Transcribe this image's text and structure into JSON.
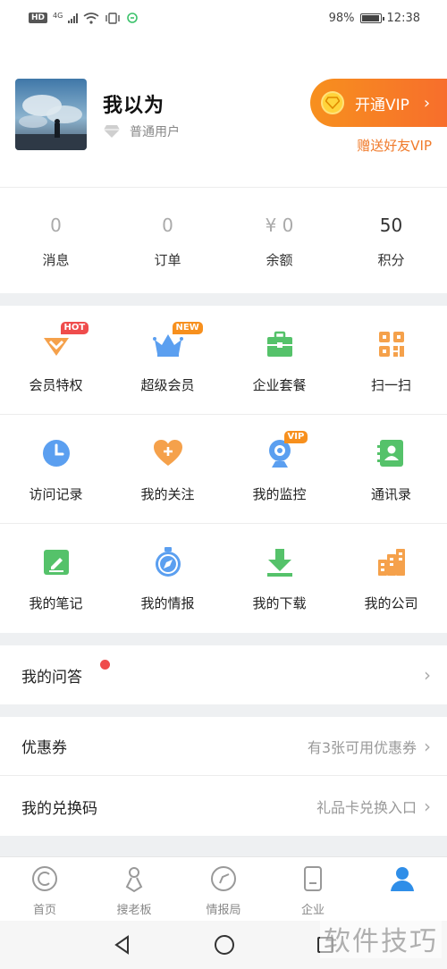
{
  "status_bar": {
    "hd": "HD",
    "network": "4G",
    "battery_percent": "98%",
    "battery_level": 0.98,
    "time": "12:38"
  },
  "profile": {
    "username": "我以为",
    "level": "普通用户",
    "vip_button": "开通VIP",
    "gift_vip": "赠送好友VIP"
  },
  "stats": [
    {
      "value": "0",
      "label": "消息"
    },
    {
      "value": "0",
      "label": "订单"
    },
    {
      "value": "¥ 0",
      "label": "余额"
    },
    {
      "value": "50",
      "label": "积分"
    }
  ],
  "grid": [
    [
      {
        "label": "会员特权",
        "icon": "member-privilege-icon",
        "badge": "HOT"
      },
      {
        "label": "超级会员",
        "icon": "crown-icon",
        "badge": "NEW"
      },
      {
        "label": "企业套餐",
        "icon": "briefcase-icon"
      },
      {
        "label": "扫一扫",
        "icon": "qr-scan-icon"
      }
    ],
    [
      {
        "label": "访问记录",
        "icon": "clock-icon"
      },
      {
        "label": "我的关注",
        "icon": "heart-plus-icon"
      },
      {
        "label": "我的监控",
        "icon": "webcam-icon",
        "badge": "VIP"
      },
      {
        "label": "通讯录",
        "icon": "contacts-icon"
      }
    ],
    [
      {
        "label": "我的笔记",
        "icon": "note-edit-icon"
      },
      {
        "label": "我的情报",
        "icon": "compass-icon"
      },
      {
        "label": "我的下载",
        "icon": "download-icon"
      },
      {
        "label": "我的公司",
        "icon": "buildings-icon"
      }
    ]
  ],
  "rows": {
    "qa": {
      "label": "我的问答"
    },
    "coupon": {
      "label": "优惠券",
      "detail": "有3张可用优惠券"
    },
    "redeem": {
      "label": "我的兑换码",
      "detail": "礼品卡兑换入口"
    }
  },
  "tabs": [
    {
      "label": "首页",
      "icon": "home-c-icon"
    },
    {
      "label": "搜老板",
      "icon": "search-boss-icon"
    },
    {
      "label": "情报局",
      "icon": "intel-icon"
    },
    {
      "label": "企业",
      "icon": "enterprise-icon"
    },
    {
      "label": "",
      "icon": "user-icon",
      "active": true
    }
  ],
  "watermark": "软件技巧",
  "colors": {
    "accent_orange": "#f7901e",
    "accent_blue": "#2f8ee8",
    "accent_green": "#55c26a",
    "badge_red": "#ef4c4c"
  }
}
